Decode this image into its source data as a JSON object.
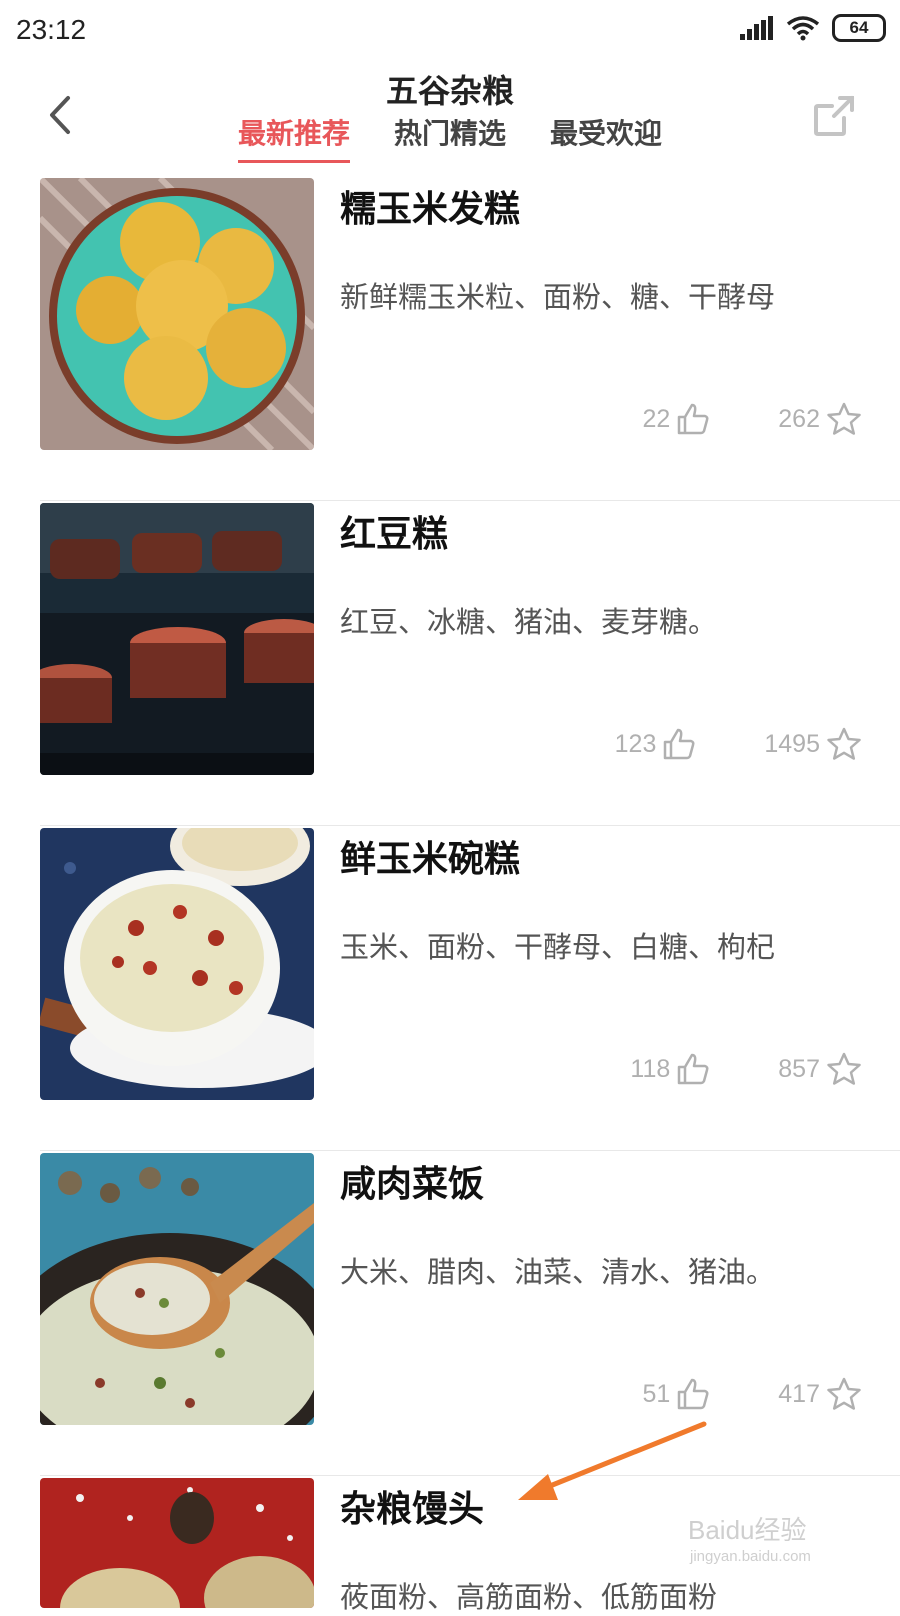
{
  "status_bar": {
    "time": "23:12",
    "battery": "64"
  },
  "header": {
    "title": "五谷杂粮",
    "tabs": [
      "最新推荐",
      "热门精选",
      "最受欢迎"
    ]
  },
  "recipes": [
    {
      "name": "糯玉米发糕",
      "ingredients": "新鲜糯玉米粒、面粉、糖、干酵母",
      "likes": "22",
      "favorites": "262"
    },
    {
      "name": "红豆糕",
      "ingredients": "红豆、冰糖、猪油、麦芽糖。",
      "likes": "123",
      "favorites": "1495"
    },
    {
      "name": "鲜玉米碗糕",
      "ingredients": "玉米、面粉、干酵母、白糖、枸杞",
      "likes": "118",
      "favorites": "857"
    },
    {
      "name": "咸肉菜饭",
      "ingredients": "大米、腊肉、油菜、清水、猪油。",
      "likes": "51",
      "favorites": "417"
    },
    {
      "name": "杂粮馒头",
      "ingredients": "莜面粉、高筋面粉、低筋面粉"
    }
  ],
  "watermark": {
    "main": "Baidu经验",
    "sub": "jingyan.baidu.com"
  },
  "colors": {
    "accent": "#e8575a",
    "annotation_arrow": "#f07a2c"
  }
}
